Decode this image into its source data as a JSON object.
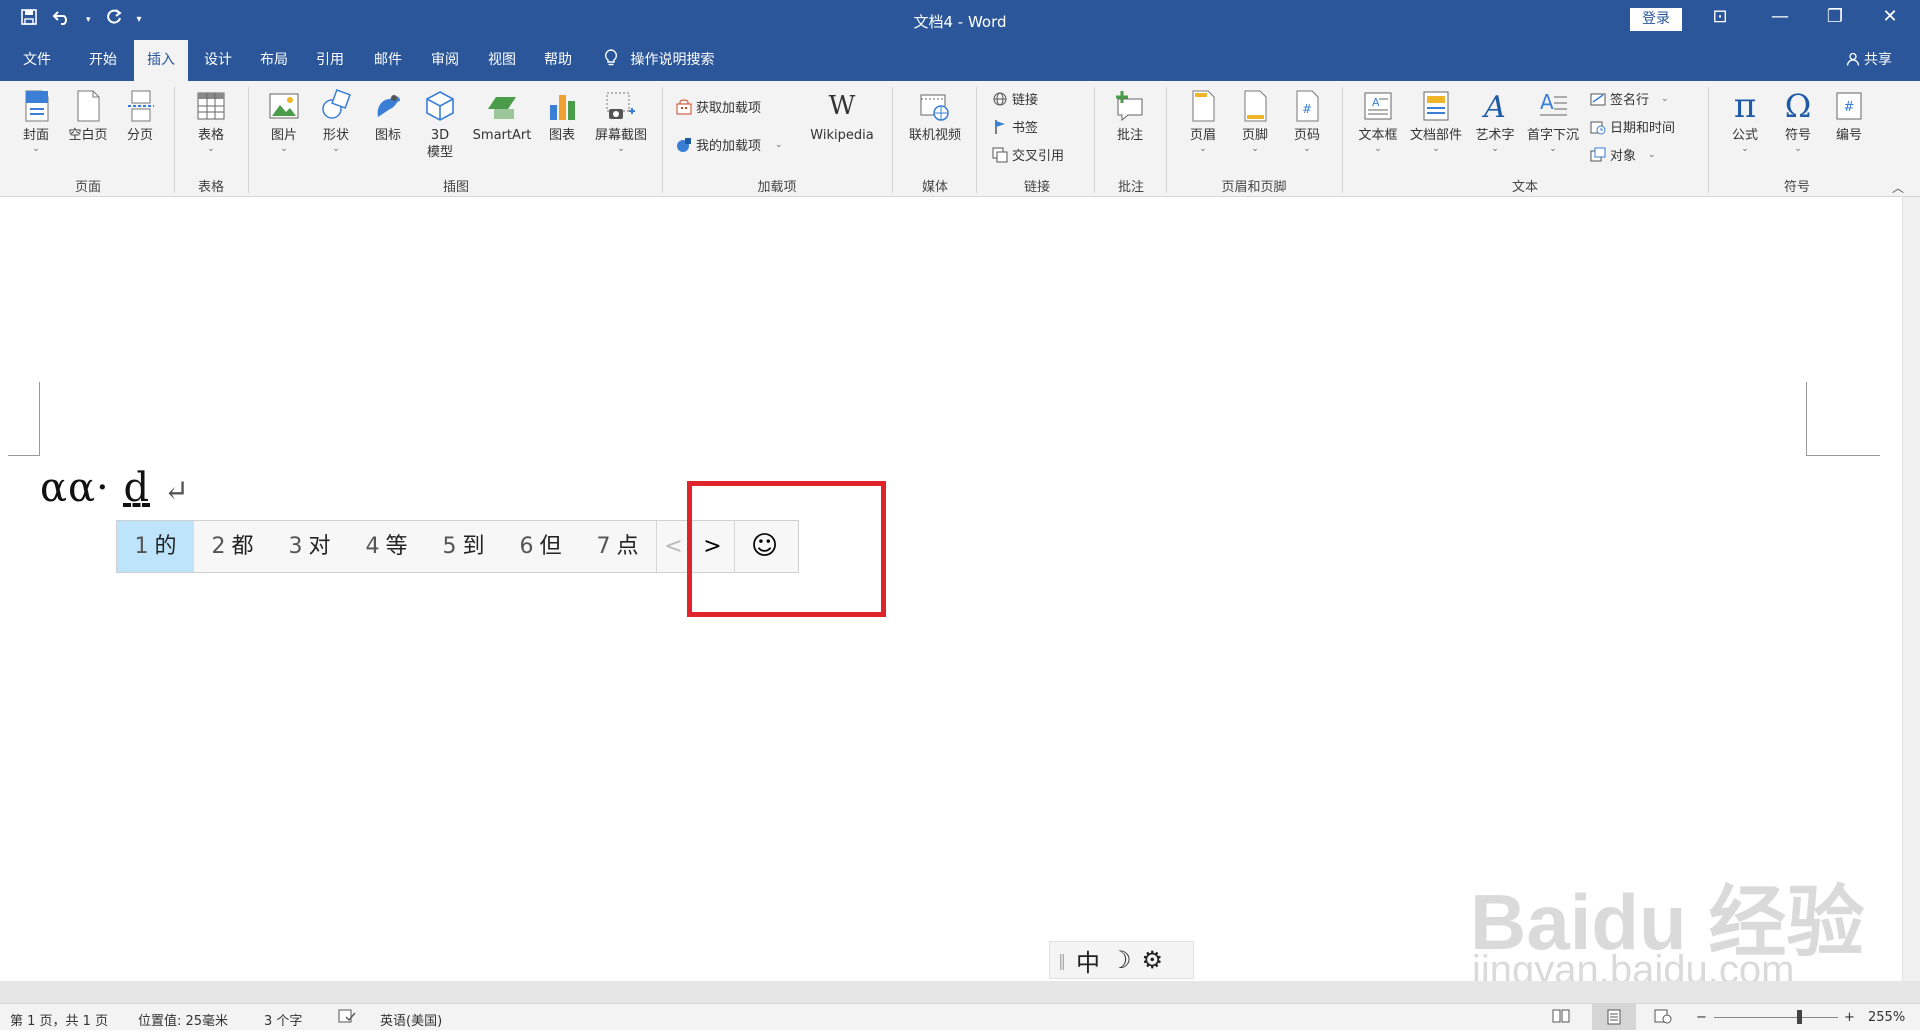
{
  "titlebar": {
    "title": "文档4  -  Word",
    "login": "登录",
    "qat": {
      "save_icon": "save-icon",
      "undo_icon": "undo-icon",
      "redo_icon": "redo-icon",
      "more": "▾"
    },
    "controls": {
      "ribbon_display": "⊡",
      "minimize": "—",
      "restore": "❐",
      "close": "✕"
    }
  },
  "tabs": [
    {
      "label": "文件"
    },
    {
      "label": "开始"
    },
    {
      "label": "插入"
    },
    {
      "label": "设计"
    },
    {
      "label": "布局"
    },
    {
      "label": "引用"
    },
    {
      "label": "邮件"
    },
    {
      "label": "审阅"
    },
    {
      "label": "视图"
    },
    {
      "label": "帮助"
    },
    {
      "label": "操作说明搜索"
    }
  ],
  "share": "共享",
  "ribbon": {
    "pages": {
      "cover": "封面",
      "blank": "空白页",
      "break": "分页",
      "label": "页面"
    },
    "tables": {
      "table": "表格",
      "label": "表格"
    },
    "illustrations": {
      "pictures": "图片",
      "shapes": "形状",
      "icons": "图标",
      "model3d_line1": "3D",
      "model3d_line2": "模型",
      "smartart": "SmartArt",
      "chart": "图表",
      "screenshot": "屏幕截图",
      "label": "插图"
    },
    "addins": {
      "get": "获取加载项",
      "my": "我的加载项",
      "wikipedia": "Wikipedia",
      "label": "加载项"
    },
    "media": {
      "video": "联机视频",
      "label": "媒体"
    },
    "links": {
      "link": "链接",
      "bookmark": "书签",
      "crossref": "交叉引用",
      "label": "链接"
    },
    "comments": {
      "comment": "批注",
      "label": "批注"
    },
    "headerfooter": {
      "header": "页眉",
      "footer": "页脚",
      "pagenum": "页码",
      "label": "页眉和页脚"
    },
    "text": {
      "textbox": "文本框",
      "quickparts": "文档部件",
      "wordart": "艺术字",
      "dropcap": "首字下沉",
      "signature": "签名行",
      "datetime": "日期和时间",
      "object": "对象",
      "label": "文本"
    },
    "symbols": {
      "equation": "公式",
      "symbol": "符号",
      "number": "编号",
      "label": "符号"
    }
  },
  "document": {
    "text_main": "αα·",
    "text_u": "d",
    "return_mark": "↵"
  },
  "ime": {
    "candidates": [
      {
        "n": "1",
        "c": "的"
      },
      {
        "n": "2",
        "c": "都"
      },
      {
        "n": "3",
        "c": "对"
      },
      {
        "n": "4",
        "c": "等"
      },
      {
        "n": "5",
        "c": "到"
      },
      {
        "n": "6",
        "c": "但"
      },
      {
        "n": "7",
        "c": "点"
      }
    ],
    "prev": "<",
    "next": ">",
    "emoji": "☺"
  },
  "imebar": {
    "mode": "中",
    "moon": "☽",
    "gear": "⚙"
  },
  "watermark": {
    "line1": "Baidu 经验",
    "line2": "jingyan.baidu.com"
  },
  "statusbar": {
    "page": "第 1 页，共 1 页",
    "position": "位置值: 25毫米",
    "words": "3 个字",
    "language": "英语(美国)",
    "zoom": "255%",
    "minus": "−",
    "plus": "+"
  }
}
